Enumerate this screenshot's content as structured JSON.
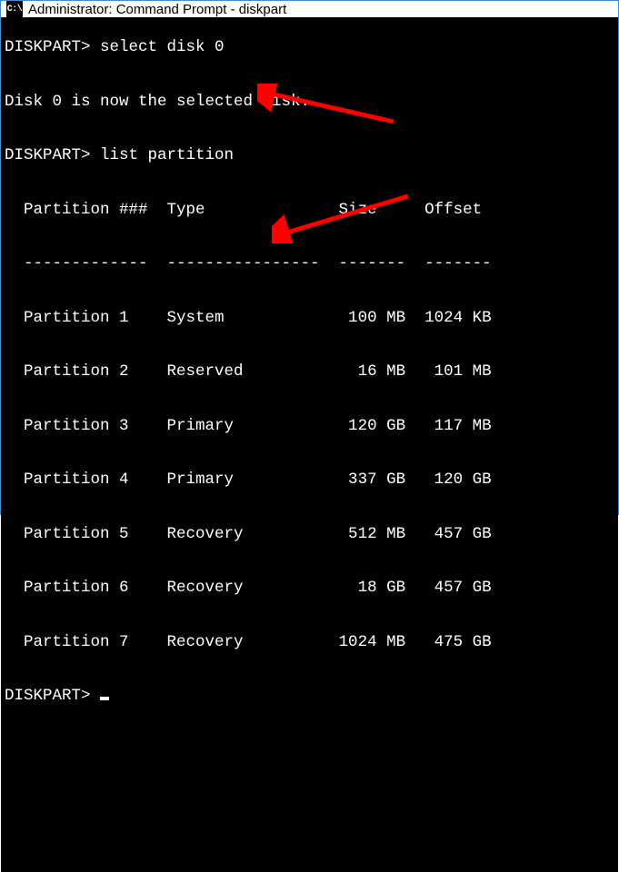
{
  "window": {
    "title": "Administrator: Command Prompt - diskpart",
    "icon_label": "C:\\"
  },
  "terminal": {
    "prompt1": "DISKPART> ",
    "cmd1": "select disk 0",
    "response1": "Disk 0 is now the selected disk.",
    "prompt2": "DISKPART> ",
    "cmd2": "list partition",
    "table": {
      "header": "  Partition ###  Type              Size     Offset",
      "divider": "  -------------  ----------------  -------  -------",
      "rows": [
        "  Partition 1    System             100 MB  1024 KB",
        "  Partition 2    Reserved            16 MB   101 MB",
        "  Partition 3    Primary            120 GB   117 MB",
        "  Partition 4    Primary            337 GB   120 GB",
        "  Partition 5    Recovery           512 MB   457 GB",
        "  Partition 6    Recovery            18 GB   457 GB",
        "  Partition 7    Recovery          1024 MB   475 GB"
      ]
    },
    "prompt3": "DISKPART> "
  },
  "annotations": {
    "arrow_color": "#ff0000"
  }
}
